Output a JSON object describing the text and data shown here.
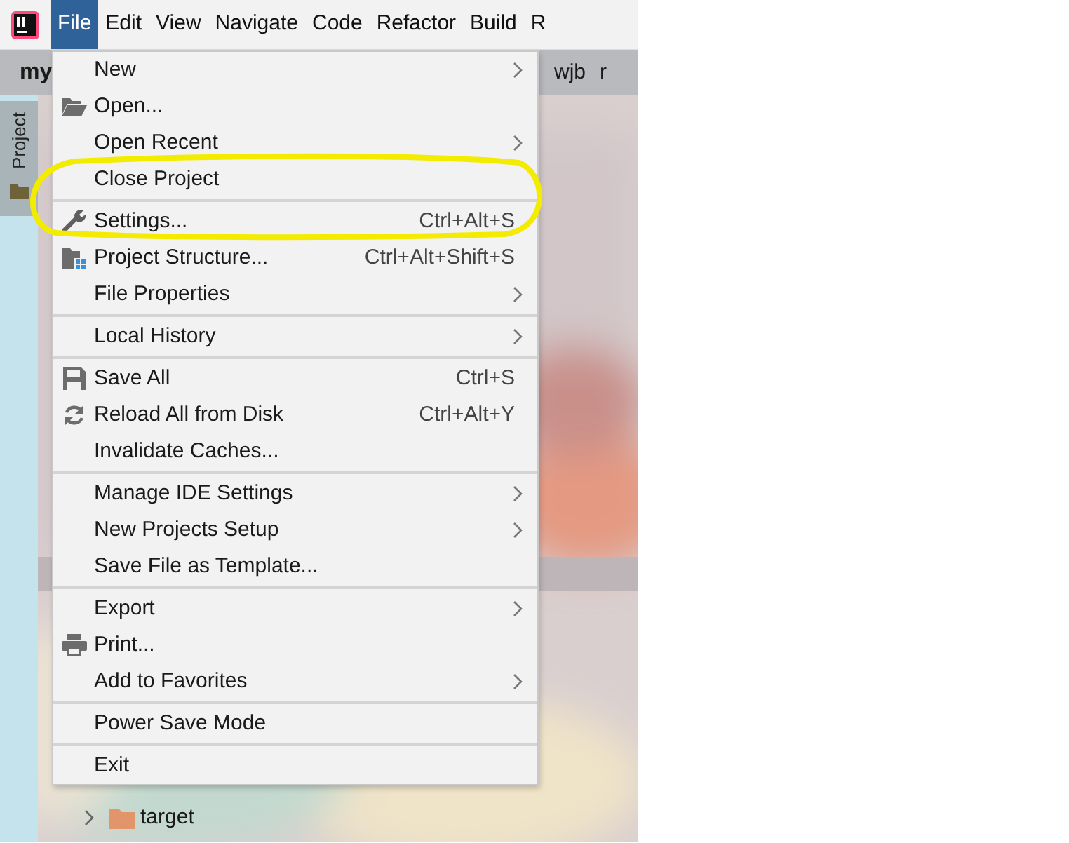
{
  "menubar": [
    {
      "label": "File",
      "selected": true
    },
    {
      "label": "Edit",
      "selected": false
    },
    {
      "label": "View",
      "selected": false
    },
    {
      "label": "Navigate",
      "selected": false
    },
    {
      "label": "Code",
      "selected": false
    },
    {
      "label": "Refactor",
      "selected": false
    },
    {
      "label": "Build",
      "selected": false
    },
    {
      "label": "R",
      "selected": false
    }
  ],
  "editor_tab": "my",
  "breadcrumbs": [
    "wjb",
    "r"
  ],
  "tool_window_tab": {
    "label": "Project",
    "selected": true
  },
  "tree": [
    {
      "label": "target",
      "expanded": false
    }
  ],
  "file_menu": {
    "groups": [
      {
        "items": [
          {
            "label": "New",
            "kind": "plain",
            "submenu": true
          },
          {
            "label": "Open...",
            "kind": "open",
            "submenu": false
          },
          {
            "label": "Open Recent",
            "kind": "plain",
            "submenu": true
          },
          {
            "label": "Close Project",
            "kind": "plain",
            "submenu": false
          }
        ]
      },
      {
        "items": [
          {
            "label": "Settings...",
            "kind": "settings",
            "shortcut": "Ctrl+Alt+S",
            "submenu": false
          },
          {
            "label": "Project Structure...",
            "kind": "structure",
            "shortcut": "Ctrl+Alt+Shift+S",
            "submenu": false
          },
          {
            "label": "File Properties",
            "kind": "plain",
            "submenu": true
          }
        ]
      },
      {
        "items": [
          {
            "label": "Local History",
            "kind": "plain",
            "submenu": true
          }
        ]
      },
      {
        "items": [
          {
            "label": "Save All",
            "kind": "save",
            "shortcut": "Ctrl+S",
            "submenu": false
          },
          {
            "label": "Reload All from Disk",
            "kind": "reload",
            "shortcut": "Ctrl+Alt+Y",
            "submenu": false
          },
          {
            "label": "Invalidate Caches...",
            "kind": "plain",
            "submenu": false
          }
        ]
      },
      {
        "items": [
          {
            "label": "Manage IDE Settings",
            "kind": "plain",
            "submenu": true
          },
          {
            "label": "New Projects Setup",
            "kind": "plain",
            "submenu": true
          },
          {
            "label": "Save File as Template...",
            "kind": "plain",
            "submenu": false
          }
        ]
      },
      {
        "items": [
          {
            "label": "Export",
            "kind": "plain",
            "submenu": true
          },
          {
            "label": "Print...",
            "kind": "print",
            "submenu": false
          },
          {
            "label": "Add to Favorites",
            "kind": "plain",
            "submenu": true
          }
        ]
      },
      {
        "items": [
          {
            "label": "Power Save Mode",
            "kind": "plain",
            "submenu": false
          }
        ]
      },
      {
        "items": [
          {
            "label": "Exit",
            "kind": "plain",
            "submenu": false
          }
        ]
      }
    ]
  }
}
